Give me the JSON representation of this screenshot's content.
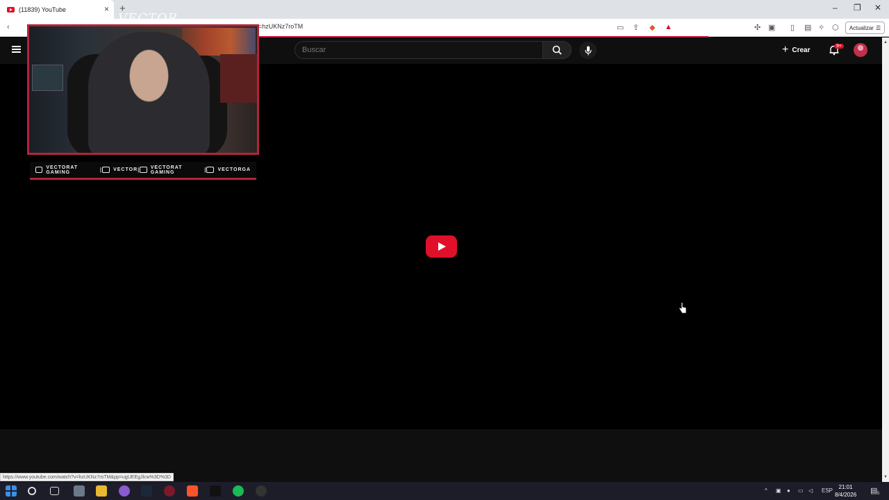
{
  "browser": {
    "tab_title": "(11839) YouTube",
    "tab_close": "×",
    "new_tab": "+",
    "address": "=hzUKNz7roTM",
    "update_label": "Actualizar",
    "status_url": "https://www.youtube.com/watch?v=hzUKNz7roTM&pp=ugUEEgJlcw%3D%3D",
    "window_controls": [
      "–",
      "❐",
      "✕"
    ]
  },
  "youtube": {
    "search_placeholder": "Buscar",
    "create_label": "Crear",
    "notification_badge": "9+",
    "accent_color": "#e0102a"
  },
  "overlay": {
    "brand_text": "VECTOR",
    "social": [
      {
        "icon": "youtube-icon",
        "label": "VECTORAT GAMING"
      },
      {
        "icon": "twitch-icon",
        "label": "VECTOR"
      },
      {
        "icon": "twitter-icon",
        "label": "VECTORAT GAMING"
      },
      {
        "icon": "instagram-icon",
        "label": "VECTORGA"
      }
    ],
    "frame_color": "#b3243a"
  },
  "taskbar": {
    "language": "ESP",
    "time": "21:01",
    "date": "8/4/2026",
    "notification_count": "5"
  }
}
